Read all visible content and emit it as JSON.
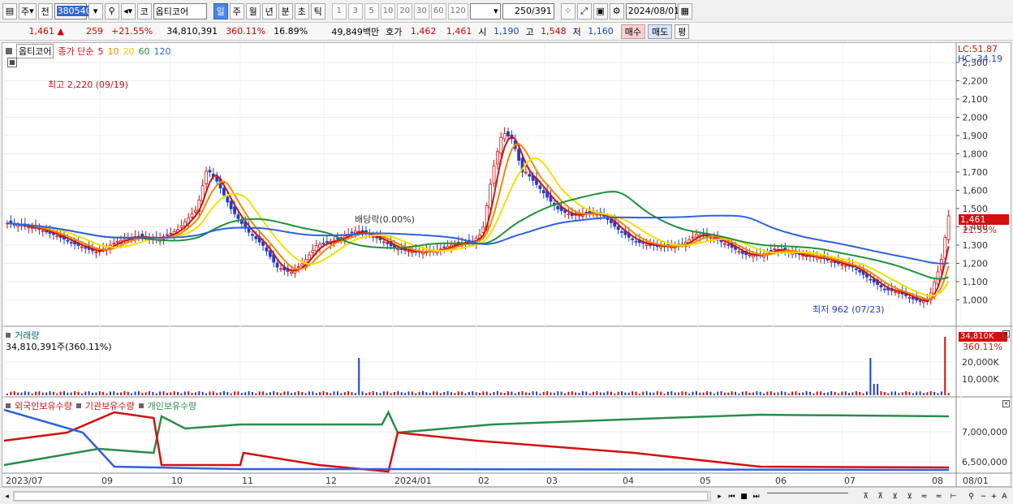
{
  "toolbar": {
    "period": "주",
    "prev_label": "전",
    "code": "380540",
    "market_label": "코",
    "stock_name": "옵티코어",
    "period_buttons": [
      "일",
      "주",
      "월",
      "년",
      "분",
      "초",
      "틱"
    ],
    "num_buttons": [
      "1",
      "3",
      "5",
      "10",
      "20",
      "30",
      "60",
      "120"
    ],
    "count": "250",
    "total": "/391",
    "date": "2024/08/01"
  },
  "info": {
    "price": "1,461",
    "arrow": "▲",
    "change": "259",
    "change_pct": "+21.55%",
    "volume": "34,810,391",
    "volume_pct": "360.11%",
    "turnover": "16.89%",
    "amount": "49,849백만",
    "ask_label": "호가",
    "ask1": "1,462",
    "ask2": "1,461",
    "open_label": "시",
    "open": "1,190",
    "high_label": "고",
    "high": "1,548",
    "low_label": "저",
    "low": "1,160",
    "buy_label": "매수",
    "sell_label": "매도",
    "avg_label": "평"
  },
  "price_panel": {
    "legend_name": "옵티코어",
    "legend_ma_label": "종가 단순",
    "legend_periods": [
      "5",
      "10",
      "20",
      "60",
      "120"
    ],
    "lc": "LC:51.87",
    "hc": "HC:-34.19",
    "y_ticks": [
      "2,300",
      "2,200",
      "2,100",
      "2,000",
      "1,900",
      "1,800",
      "1,700",
      "1,600",
      "1,500",
      "1,400",
      "1,300",
      "1,200",
      "1,100",
      "1,000"
    ],
    "current_price": "1,461",
    "current_pct": "21.55%",
    "annot_high": "최고 2,220 (09/19)",
    "annot_low": "최저 962 (07/23)",
    "annot_div": "배당락(0.00%)"
  },
  "volume_panel": {
    "title": "거래량",
    "value": "34,810,391주(360.11%)",
    "y_ticks": [
      "20,000K",
      "10,000K"
    ],
    "current": "34,810K",
    "current_pct": "360.11%"
  },
  "holding_panel": {
    "legend": [
      "외국인보유수량",
      "기관보유수량",
      "개인보유수량"
    ],
    "y_ticks": [
      "7,000,000",
      "6,500,000"
    ]
  },
  "x_axis": [
    "2023/07",
    "09",
    "10",
    "11",
    "12",
    "2024/01",
    "02",
    "03",
    "04",
    "05",
    "06",
    "07",
    "08",
    "08/01"
  ],
  "chart_data": {
    "type": "line",
    "title": "",
    "y_unit": "KRW",
    "series": [
      {
        "name": "5",
        "color": "#d21010"
      },
      {
        "name": "10",
        "color": "#f08a00"
      },
      {
        "name": "20",
        "color": "#f2e000"
      },
      {
        "name": "60",
        "color": "#21913a"
      },
      {
        "name": "120",
        "color": "#3060e0"
      }
    ],
    "price_ylim": [
      900,
      2300
    ],
    "volume_ylim": [
      0,
      35000000
    ]
  }
}
